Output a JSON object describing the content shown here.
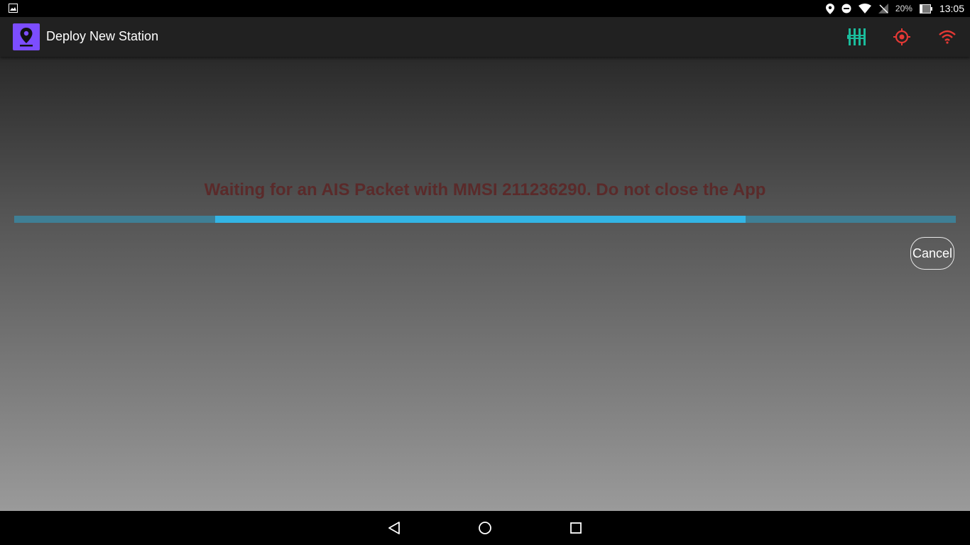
{
  "status_bar": {
    "battery_percent": "20%",
    "time": "13:05",
    "icons": [
      "image-icon",
      "location-icon",
      "do-not-disturb-icon",
      "wifi-icon",
      "no-signal-icon",
      "battery-icon"
    ]
  },
  "app_bar": {
    "title": "Deploy New Station",
    "logo_icon": "map-pin-icon",
    "actions": [
      {
        "name": "sensor-tuning-icon",
        "color": "#1abc9c"
      },
      {
        "name": "gps-target-icon",
        "color": "#e53935"
      },
      {
        "name": "wifi-status-icon",
        "color": "#e53935"
      }
    ],
    "logo_color": "#7c4dff"
  },
  "main": {
    "waiting_message": "Waiting for an AIS Packet with MMSI 211236290. Do not close the App",
    "progress_indicator": "indeterminate",
    "cancel_label": "Cancel"
  },
  "colors": {
    "message_text": "#5a2a2a",
    "progress_track": "#3f7f95",
    "progress_fill": "#33b5e5"
  },
  "nav_bar": {
    "buttons": [
      "back-icon",
      "home-icon",
      "recents-icon"
    ]
  }
}
